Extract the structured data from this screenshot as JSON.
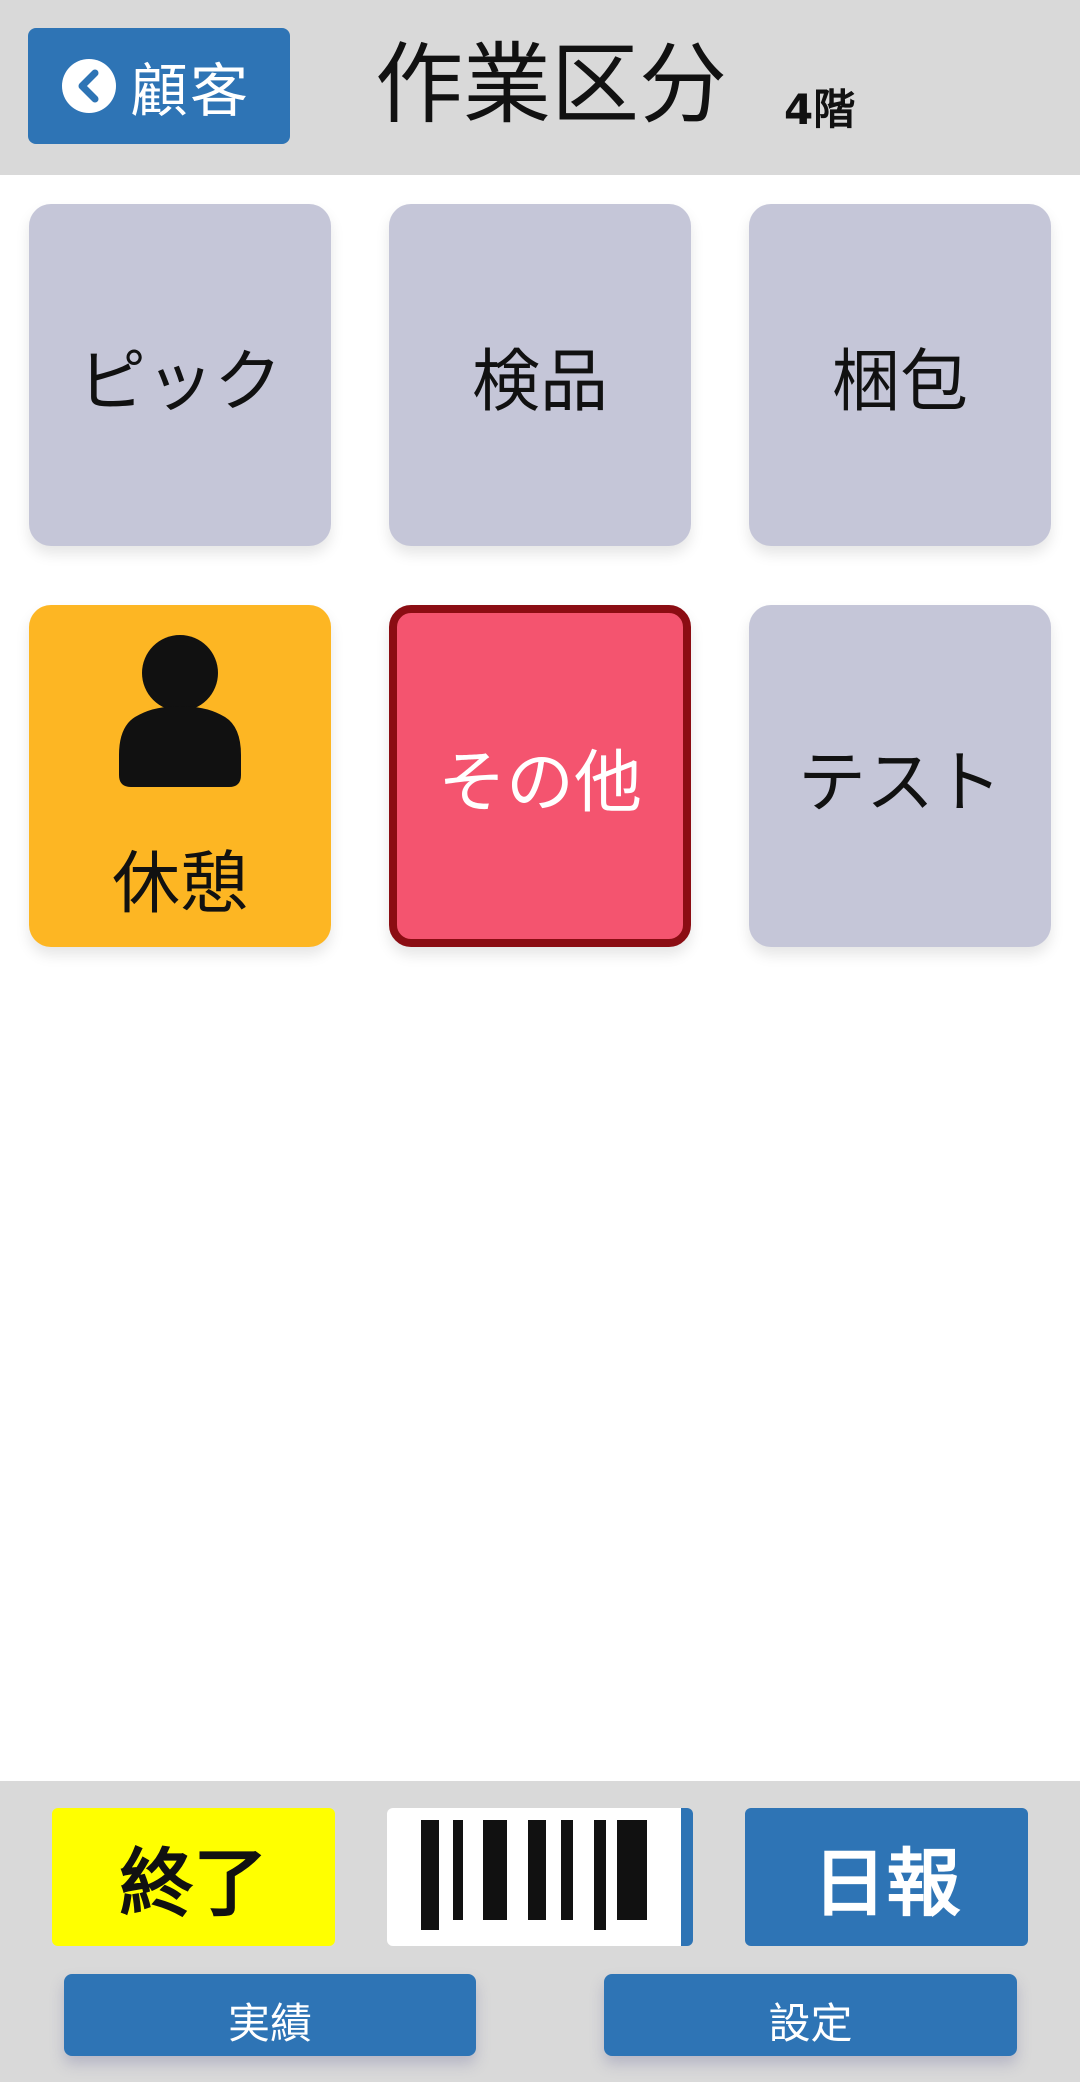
{
  "header": {
    "back_label": "顧客",
    "title": "作業区分",
    "floor": "4階"
  },
  "tiles": [
    {
      "label": "ピック"
    },
    {
      "label": "検品"
    },
    {
      "label": "梱包"
    },
    {
      "label": "休憩",
      "icon": "person-icon"
    },
    {
      "label": "その他"
    },
    {
      "label": "テスト"
    }
  ],
  "footer": {
    "end_label": "終了",
    "barcode_icon": "barcode-icon",
    "daily_label": "日報",
    "results_label": "実績",
    "settings_label": "設定"
  },
  "colors": {
    "header_bg": "#d9d9d9",
    "primary_blue": "#2e74b5",
    "tile_gray": "#c5c6d8",
    "break_orange": "#fdb623",
    "selected_red": "#f4546f",
    "selected_border": "#8b0d13",
    "end_yellow": "#ffff00"
  }
}
